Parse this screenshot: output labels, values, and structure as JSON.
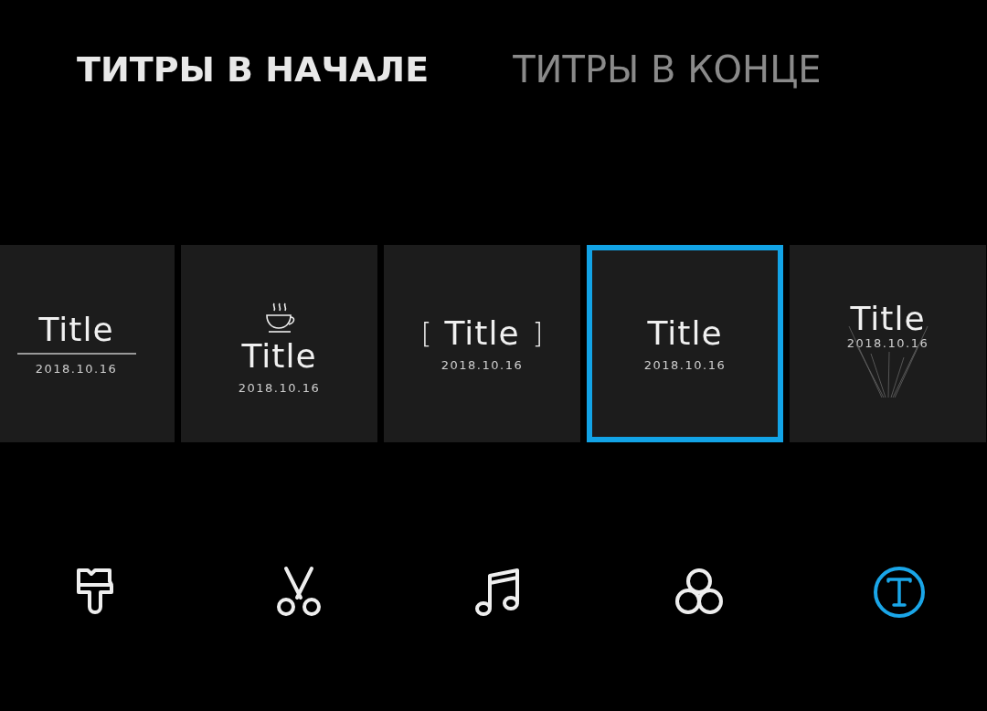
{
  "tabs": [
    {
      "label": "ТИТРЫ В НАЧАЛЕ",
      "selected": true
    },
    {
      "label": "ТИТРЫ В КОНЦЕ",
      "selected": false
    }
  ],
  "templates": [
    {
      "kind": "underline",
      "title": "Title",
      "date": "2018.10.16",
      "selected": false
    },
    {
      "kind": "cup",
      "title": "Title",
      "date": "2018.10.16",
      "selected": false
    },
    {
      "kind": "brackets",
      "title": "Title",
      "date": "2018.10.16",
      "left_mark": "[",
      "right_mark": "]",
      "selected": false
    },
    {
      "kind": "plain",
      "title": "Title",
      "date": "2018.10.16",
      "selected": true
    },
    {
      "kind": "rays",
      "title": "Title",
      "date": "2018.10.16",
      "selected": false
    }
  ],
  "tools": [
    {
      "kind": "brush",
      "selected": false
    },
    {
      "kind": "scissors",
      "selected": false
    },
    {
      "kind": "music",
      "selected": false
    },
    {
      "kind": "filters",
      "selected": false
    },
    {
      "kind": "text",
      "selected": true
    }
  ]
}
